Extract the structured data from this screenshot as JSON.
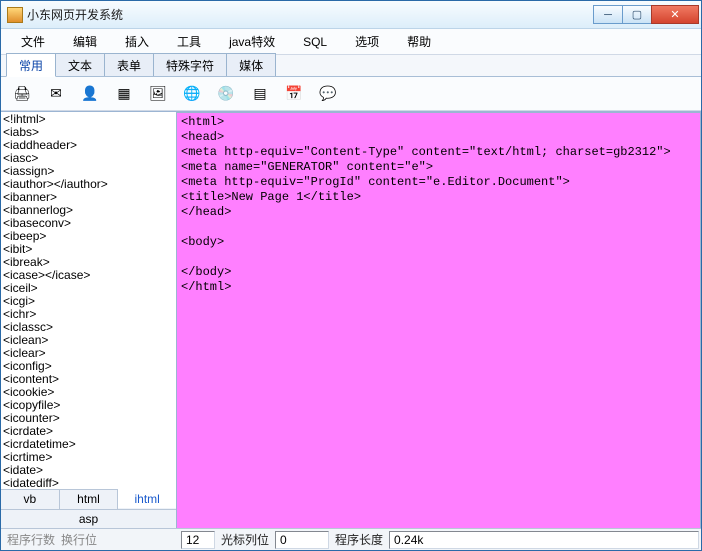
{
  "window": {
    "title": "小东网页开发系统"
  },
  "menu": [
    "文件",
    "编辑",
    "插入",
    "工具",
    "java特效",
    "SQL",
    "选项",
    "帮助"
  ],
  "tabs": [
    {
      "label": "常用",
      "active": true
    },
    {
      "label": "文本",
      "active": false
    },
    {
      "label": "表单",
      "active": false
    },
    {
      "label": "特殊字符",
      "active": false
    },
    {
      "label": "媒体",
      "active": false
    }
  ],
  "tools": [
    {
      "name": "print-icon",
      "glyph": "🖨"
    },
    {
      "name": "mail-icon",
      "glyph": "✉"
    },
    {
      "name": "person-icon",
      "glyph": "👤"
    },
    {
      "name": "form-icon",
      "glyph": "▦"
    },
    {
      "name": "image-icon",
      "glyph": "🖼"
    },
    {
      "name": "globe-icon",
      "glyph": "🌐"
    },
    {
      "name": "disc-icon",
      "glyph": "💿"
    },
    {
      "name": "table-icon",
      "glyph": "▤"
    },
    {
      "name": "calendar-icon",
      "glyph": "📅"
    },
    {
      "name": "chat-icon",
      "glyph": "💬"
    }
  ],
  "tag_list": [
    "<!ihtml>",
    "<iabs>",
    "<iaddheader>",
    "<iasc>",
    "<iassign>",
    "<iauthor></iauthor>",
    "<ibanner>",
    "<ibannerlog>",
    "<ibaseconv>",
    "<ibeep>",
    "<ibit>",
    "<ibreak>",
    "<icase></icase>",
    "<iceil>",
    "<icgi>",
    "<ichr>",
    "<iclassc>",
    "<iclean>",
    "<iclear>",
    "<iconfig>",
    "<icontent>",
    "<icookie>",
    "<icopyfile>",
    "<icounter>",
    "<icrdate>",
    "<icrdatetime>",
    "<icrtime>",
    "<idate>",
    "<idatediff>"
  ],
  "lang_tabs": {
    "row1": [
      {
        "label": "vb",
        "active": false
      },
      {
        "label": "html",
        "active": false
      },
      {
        "label": "ihtml",
        "active": true
      }
    ],
    "row2": [
      {
        "label": "asp",
        "active": false
      }
    ]
  },
  "code": "<html>\n<head>\n<meta http-equiv=\"Content-Type\" content=\"text/html; charset=gb2312\">\n<meta name=\"GENERATOR\" content=\"e\">\n<meta http-equiv=\"ProgId\" content=\"e.Editor.Document\">\n<title>New Page 1</title>\n</head>\n\n<body>\n\n</body>\n</html>\n",
  "status": {
    "left1": "程序行数",
    "left2": "换行位",
    "line_val": "12",
    "col_label": "光标列位",
    "col_val": "0",
    "len_label": "程序长度",
    "len_val": "0.24k"
  }
}
